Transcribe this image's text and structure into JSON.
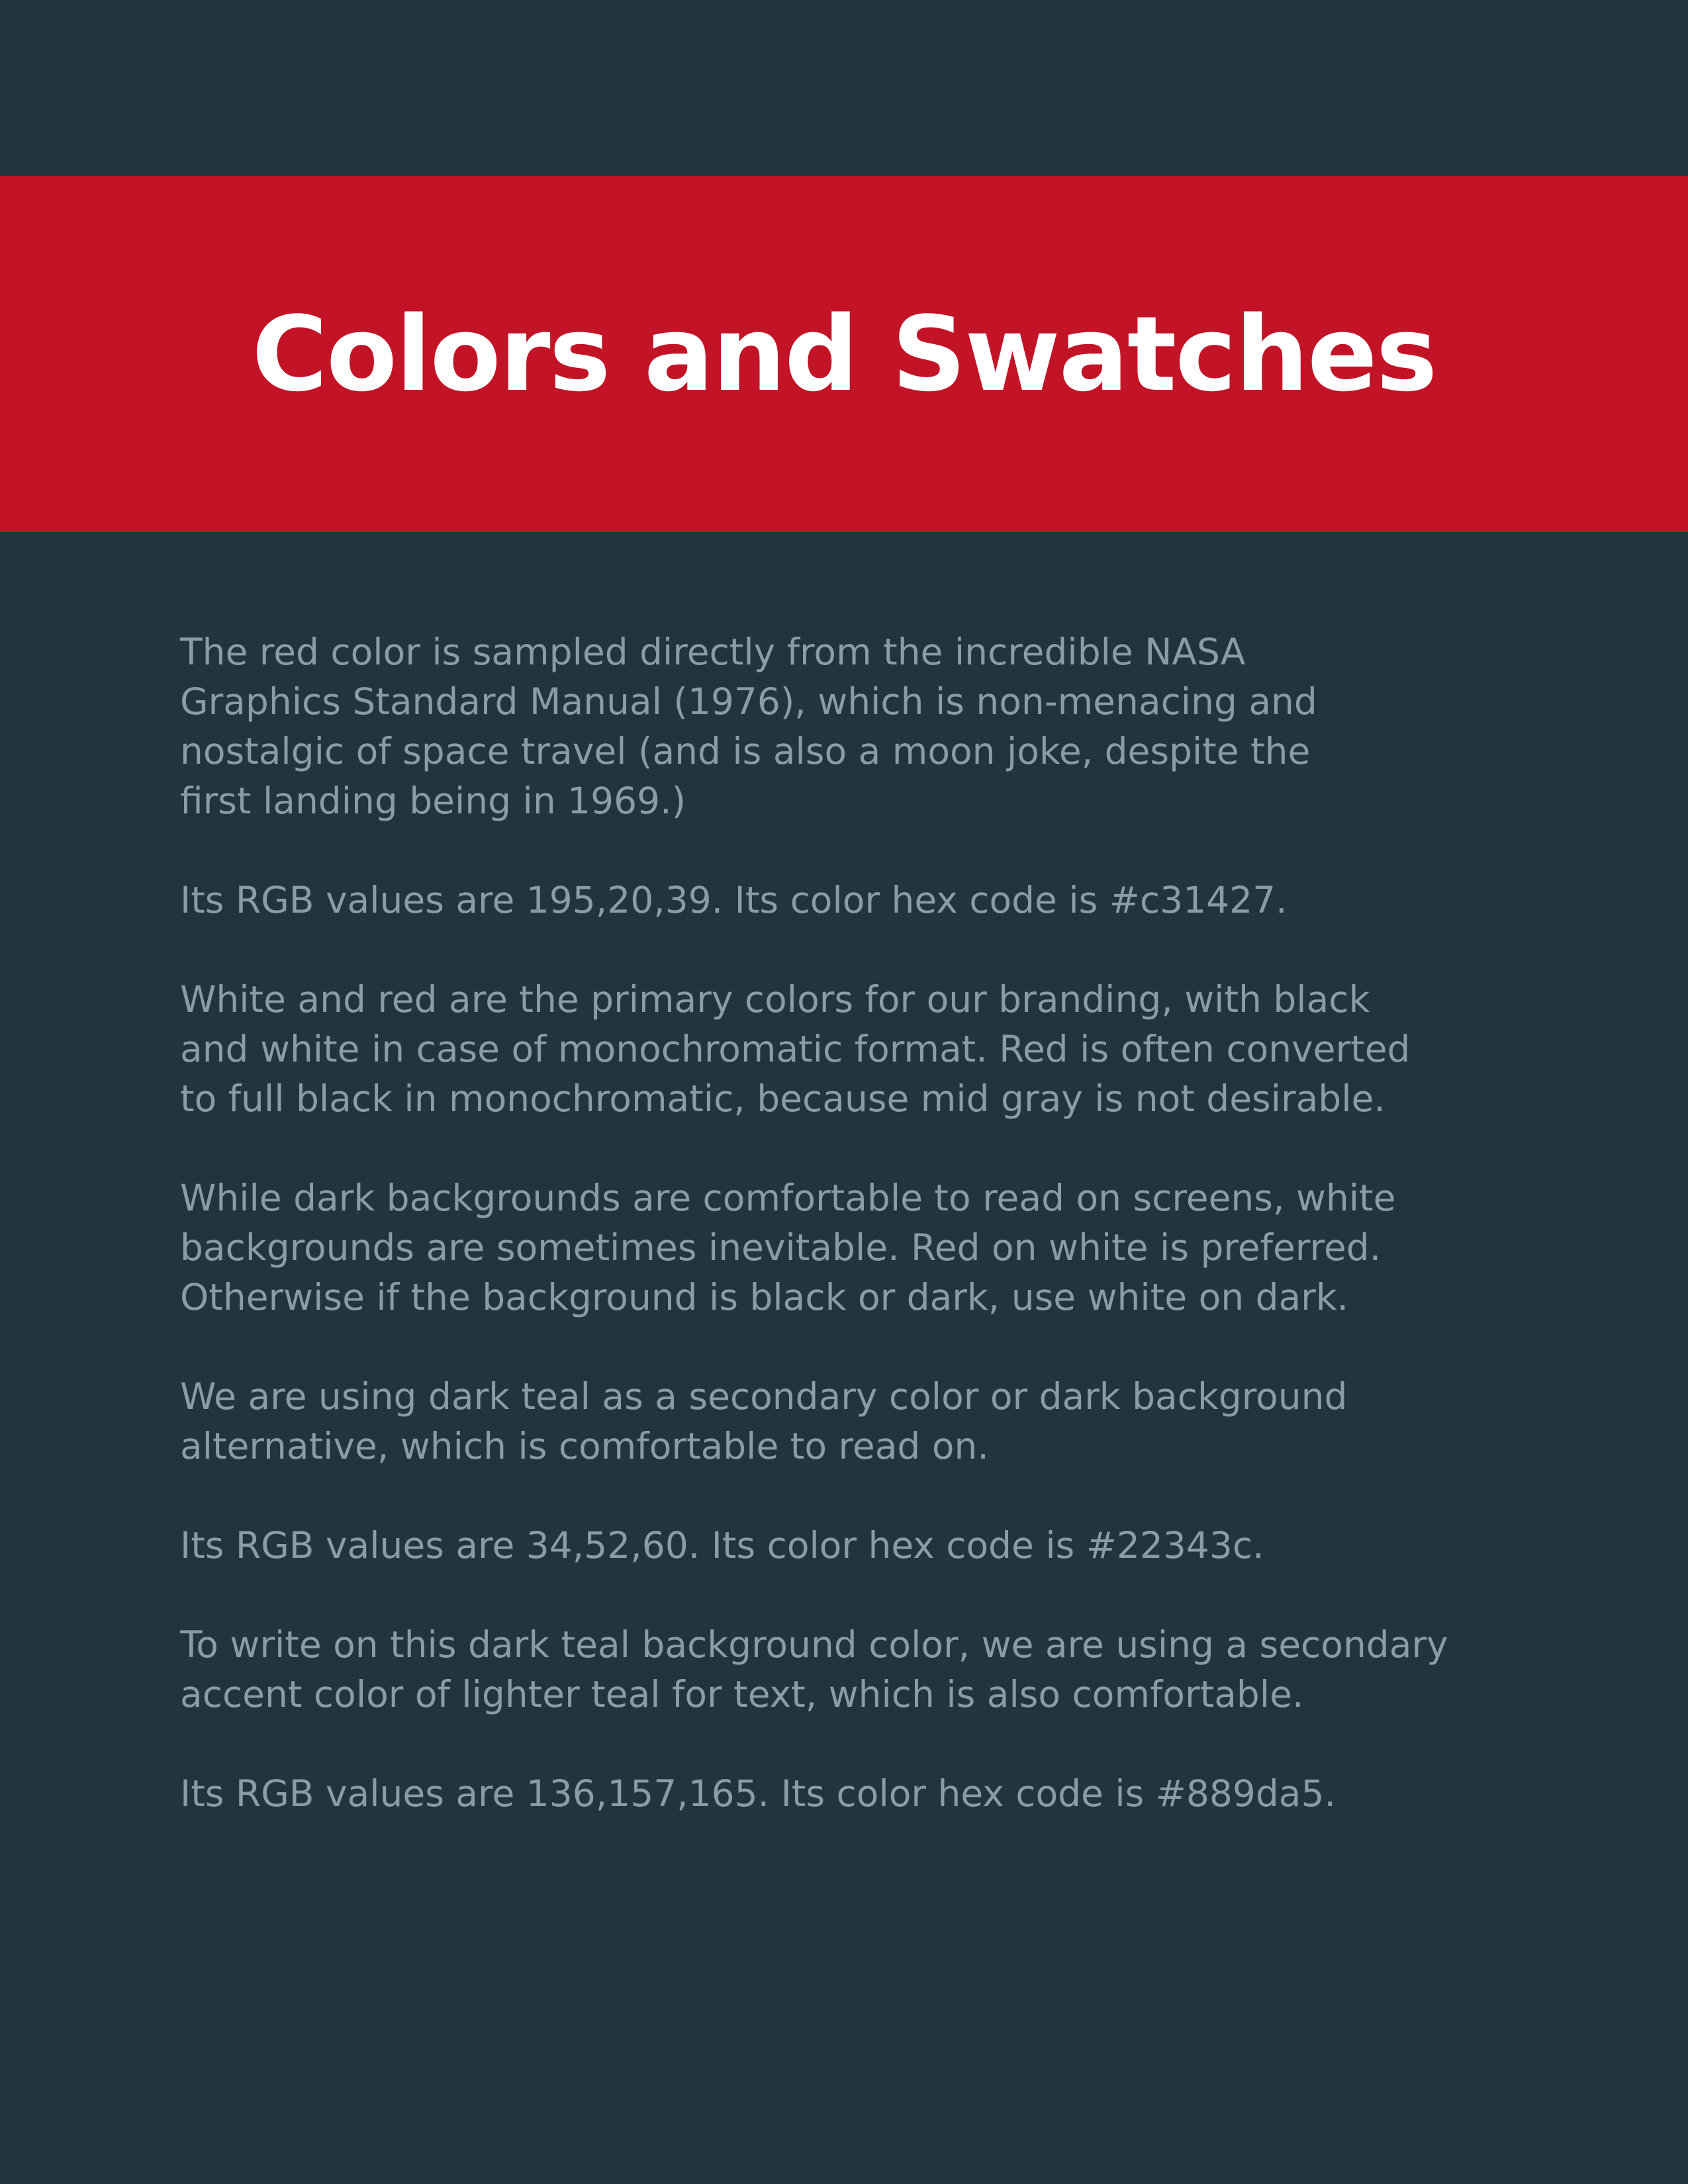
{
  "page": {
    "title": "Colors and Swatches",
    "colors": {
      "background": "#22343c",
      "banner": "#c31427",
      "title_text": "#ffffff",
      "body_text": "#889da5"
    },
    "paragraphs": [
      {
        "lines": [
          "The red color is sampled directly from the incredible NASA",
          "Graphics Standard Manual (1976), which is non-menacing and",
          "nostalgic of space travel (and is also a moon joke, despite the",
          "first landing being in 1969.)"
        ]
      },
      {
        "lines": [
          "Its RGB values are 195,20,39. Its color hex code is #c31427."
        ]
      },
      {
        "lines": [
          "White and red are the primary colors for our branding, with black",
          "and white in case of monochromatic format. Red is often converted",
          "to full black in monochromatic, because mid gray is not desirable."
        ]
      },
      {
        "lines": [
          "While dark backgrounds are comfortable to read on screens, white",
          "backgrounds are sometimes inevitable. Red on white is preferred.",
          "Otherwise if the background is black or dark, use white on dark."
        ]
      },
      {
        "lines": [
          "We are using dark teal as a secondary color or dark background",
          "alternative, which is comfortable to read on."
        ]
      },
      {
        "lines": [
          "Its RGB values are 34,52,60. Its color hex code is #22343c."
        ]
      },
      {
        "lines": [
          "To write on this dark teal background color, we are using a secondary",
          "accent color of lighter teal for text, which is also comfortable."
        ]
      },
      {
        "lines": [
          "Its RGB values are 136,157,165. Its color hex code is #889da5."
        ]
      }
    ]
  }
}
